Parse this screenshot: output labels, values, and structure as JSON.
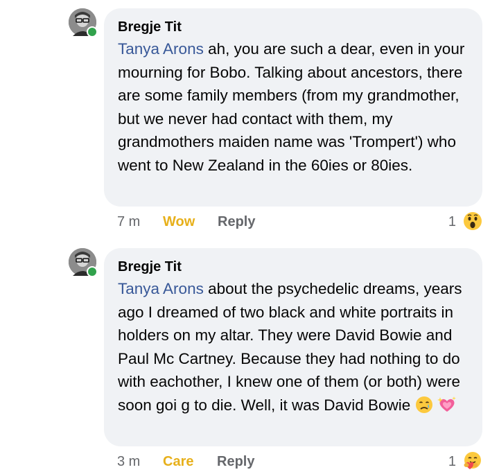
{
  "comments": [
    {
      "author": "Bregje Tit",
      "mention": "Tanya Arons",
      "text": " ah, you are such a dear, even in your mourning for Bobo. Talking about ancestors, there are some family members (from my grandmother, but we never had contact with them, my grandmothers maiden name was 'Trompert') who went to New Zealand in the 60ies or 80ies.",
      "time": "7 m",
      "reaction_label": "Wow",
      "reaction_color": "#e7b01b",
      "reply_label": "Reply",
      "reaction_count": "1",
      "reaction_icon": "wow-emoji-icon",
      "inline_icons": []
    },
    {
      "author": "Bregje Tit",
      "mention": "Tanya Arons",
      "text": " about the psychedelic dreams, years ago I dreamed of two black and white portraits in holders on my altar. They were David Bowie and Paul Mc Cartney. Because they had nothing to do with eachother, I knew one of them (or both) were soon goi g to die. Well, it was David Bowie ",
      "time": "3 m",
      "reaction_label": "Care",
      "reaction_color": "#e7b01b",
      "reply_label": "Reply",
      "reaction_count": "1",
      "reaction_icon": "care-emoji-icon",
      "inline_icons": [
        "crying-face-icon",
        "sparkling-heart-icon"
      ]
    }
  ]
}
